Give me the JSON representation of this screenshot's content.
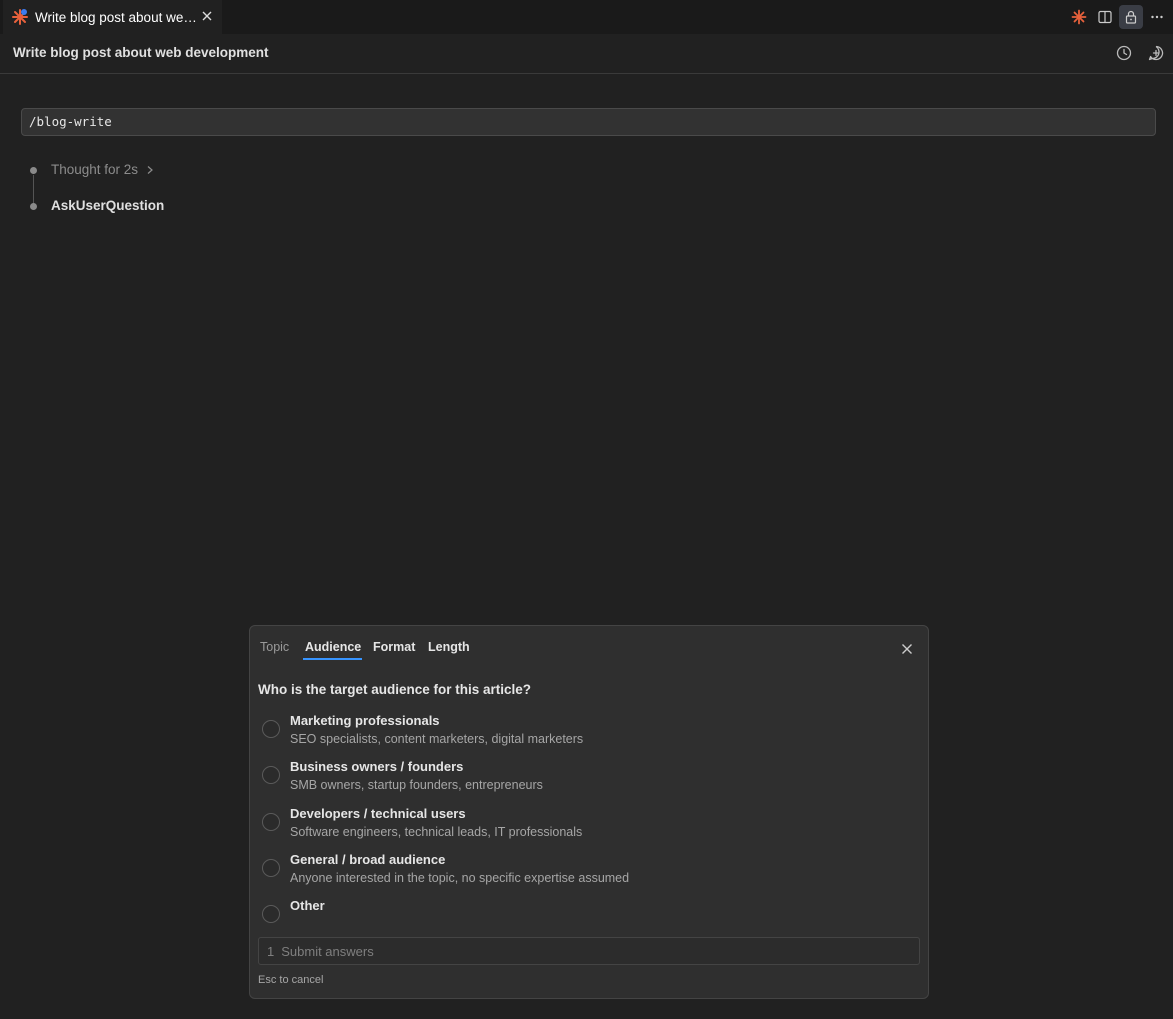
{
  "tab": {
    "title": "Write blog post about web development",
    "icon": "claude-spark-icon"
  },
  "top_actions": [
    "claude-spark-icon",
    "split-editor-icon",
    "lock-icon",
    "more-icon"
  ],
  "header": {
    "title": "Write blog post about web development",
    "icons": [
      "history-icon",
      "new-chat-icon"
    ]
  },
  "command": "/blog-write",
  "timeline": {
    "thought": "Thought for 2s",
    "tool": "AskUserQuestion"
  },
  "question_panel": {
    "tabs": [
      {
        "label": "Topic",
        "state": "normal"
      },
      {
        "label": "Audience",
        "state": "active"
      },
      {
        "label": "Format",
        "state": "bold"
      },
      {
        "label": "Length",
        "state": "bold"
      }
    ],
    "question": "Who is the target audience for this article?",
    "options": [
      {
        "label": "Marketing professionals",
        "description": "SEO specialists, content marketers, digital marketers"
      },
      {
        "label": "Business owners / founders",
        "description": "SMB owners, startup founders, entrepreneurs"
      },
      {
        "label": "Developers / technical users",
        "description": "Software engineers, technical leads, IT professionals"
      },
      {
        "label": "General / broad audience",
        "description": "Anyone interested in the topic, no specific expertise assumed"
      },
      {
        "label": "Other",
        "description": ""
      }
    ],
    "submit": {
      "number": "1",
      "label": "Submit answers"
    },
    "esc_hint": "Esc to cancel"
  },
  "colors": {
    "background": "#212121",
    "accent": "#3794ff",
    "spark": "#e8613c"
  }
}
